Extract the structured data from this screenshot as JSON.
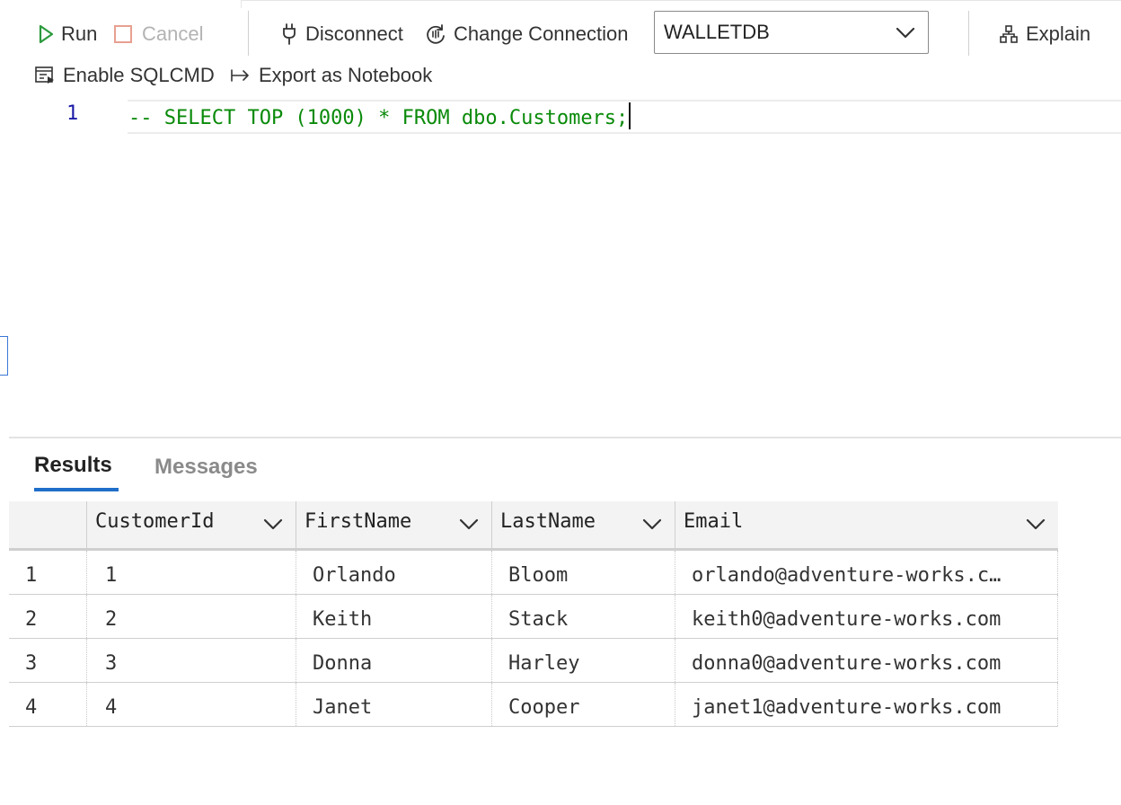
{
  "toolbar": {
    "run_label": "Run",
    "cancel_label": "Cancel",
    "disconnect_label": "Disconnect",
    "change_connection_label": "Change Connection",
    "database_selected": "WALLETDB",
    "explain_label": "Explain",
    "sqlcmd_label": "Enable SQLCMD",
    "export_label": "Export as Notebook"
  },
  "editor": {
    "lines": [
      {
        "number": "1",
        "text": "-- SELECT TOP (1000) * FROM dbo.Customers;"
      }
    ]
  },
  "results_panel": {
    "tabs": [
      {
        "label": "Results",
        "active": true
      },
      {
        "label": "Messages",
        "active": false
      }
    ],
    "columns": [
      "CustomerId",
      "FirstName",
      "LastName",
      "Email"
    ],
    "rows": [
      {
        "row_number": "1",
        "cells": [
          "1",
          "Orlando",
          "Bloom",
          "orlando@adventure-works.c…"
        ]
      },
      {
        "row_number": "2",
        "cells": [
          "2",
          "Keith",
          "Stack",
          "keith0@adventure-works.com"
        ]
      },
      {
        "row_number": "3",
        "cells": [
          "3",
          "Donna",
          "Harley",
          "donna0@adventure-works.com"
        ]
      },
      {
        "row_number": "4",
        "cells": [
          "4",
          "Janet",
          "Cooper",
          "janet1@adventure-works.com"
        ]
      }
    ]
  },
  "icons": {
    "run": "play-icon",
    "cancel": "stop-square-icon",
    "disconnect": "plug-icon",
    "change_connection": "refresh-connection-icon",
    "explain": "hierarchy-icon",
    "sqlcmd": "sqlcmd-icon",
    "export": "arrow-right-bar-icon",
    "dropdown": "chevron-down-icon"
  },
  "colors": {
    "run_icon": "#2c9a3d",
    "cancel_icon": "#e8a090",
    "keyword_comment": "#098a09",
    "line_number": "#1a1aa6",
    "accent": "#1f6ec9"
  }
}
